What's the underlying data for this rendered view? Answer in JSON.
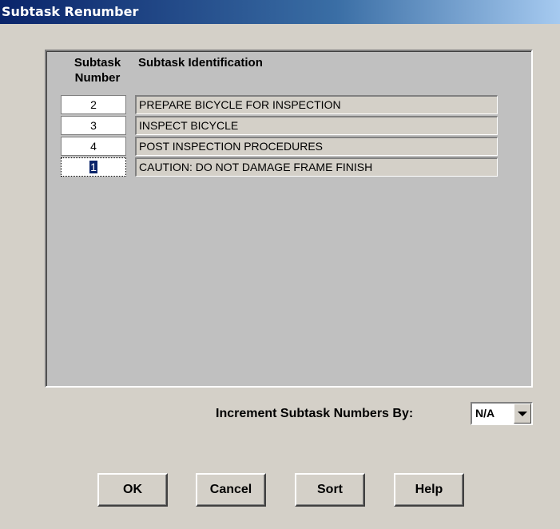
{
  "window": {
    "title": "Subtask Renumber"
  },
  "table": {
    "header_number_line1": "Subtask",
    "header_number_line2": "Number",
    "header_identification": "Subtask Identification",
    "rows": [
      {
        "number": "2",
        "identification": "PREPARE BICYCLE FOR INSPECTION"
      },
      {
        "number": "3",
        "identification": "INSPECT BICYCLE"
      },
      {
        "number": "4",
        "identification": "POST INSPECTION PROCEDURES"
      },
      {
        "number": "1",
        "identification": "CAUTION:  DO NOT DAMAGE FRAME FINISH"
      }
    ]
  },
  "increment": {
    "label": "Increment Subtask Numbers By:",
    "value": "N/A"
  },
  "buttons": {
    "ok": "OK",
    "cancel": "Cancel",
    "sort": "Sort",
    "help": "Help"
  }
}
